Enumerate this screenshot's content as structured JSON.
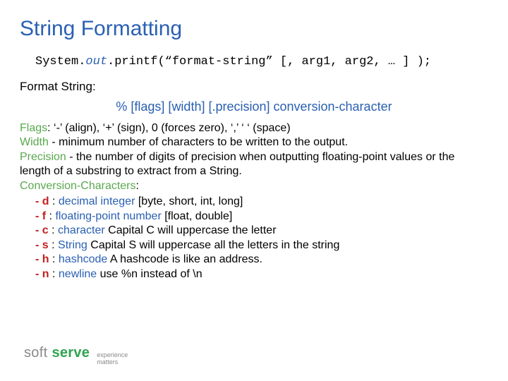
{
  "title": "String Formatting",
  "code": {
    "prefix": "System.",
    "out": "out",
    "rest": ".printf(“format-string” [, arg1, arg2, … ] );"
  },
  "format_label": "Format String:",
  "format_pattern": "% [flags] [width] [.precision] conversion-character",
  "flags": {
    "label": "Flags",
    "text": ": ‘-’ (align), ‘+’ (sign), 0 (forces zero), ‘,’ ‘ ‘ (space)"
  },
  "width": {
    "label": "Width",
    "text": " - minimum number of characters to be written to the output."
  },
  "precision": {
    "label": "Precision",
    "text": " - the number of digits of precision when outputting floating-point values or the length of a substring to extract from a String."
  },
  "conv_label": "Conversion-Characters",
  "conv_colon": ":",
  "conversions": [
    {
      "code": "d",
      "name": "decimal integer",
      "extra": " [byte, short, int, long]"
    },
    {
      "code": "f",
      "name": "floating-point number",
      "extra": " [float, double]"
    },
    {
      "code": "c",
      "name": "character",
      "extra": " Capital C will uppercase the letter"
    },
    {
      "code": "s",
      "name": "String",
      "extra": " Capital S will uppercase all the letters in the string"
    },
    {
      "code": "h",
      "name": "hashcode",
      "extra": " A hashcode is like an address."
    },
    {
      "code": "n",
      "name": "newline",
      "extra": " use %n instead of \\n"
    }
  ],
  "logo": {
    "soft": "soft",
    "serve": "serve",
    "tag1": "experience",
    "tag2": "matters"
  }
}
